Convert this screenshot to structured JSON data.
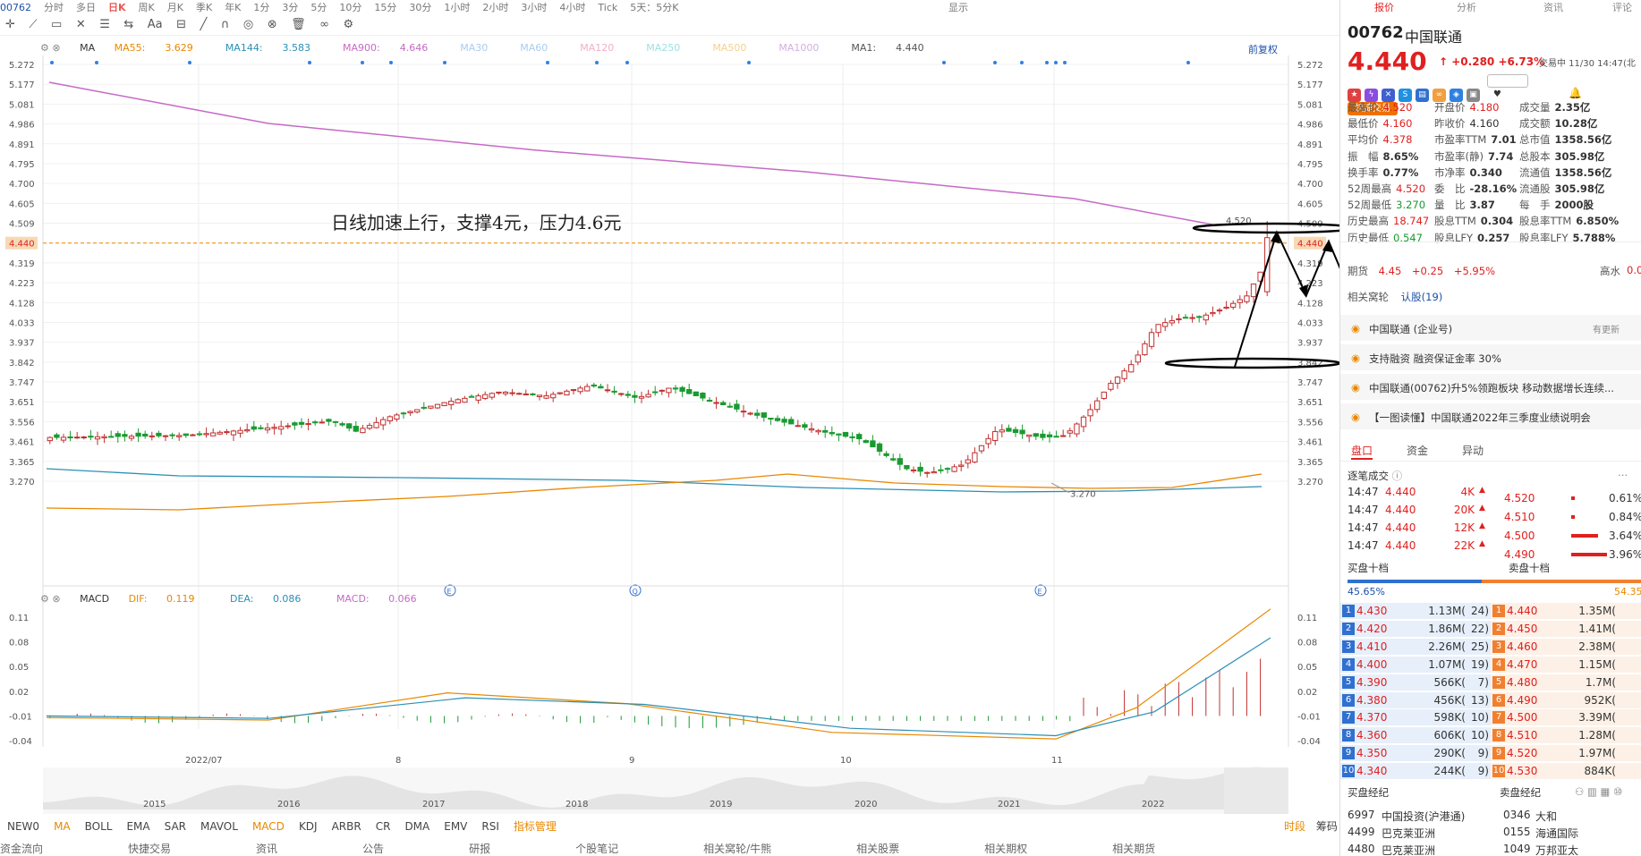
{
  "topbar": {
    "code": "00762",
    "items": [
      "分时",
      "多日",
      "日K",
      "周K",
      "月K",
      "季K",
      "年K",
      "1分",
      "3分",
      "5分",
      "10分",
      "15分",
      "30分",
      "1小时",
      "2小时",
      "3小时",
      "4小时",
      "Tick",
      "5天：5分K"
    ],
    "active_index": 2,
    "right_label": "显示"
  },
  "ma_legend": {
    "ma_label": "MA",
    "items": [
      {
        "label": "MA55:",
        "value": "3.629",
        "color": "#e88800"
      },
      {
        "label": "MA144:",
        "value": "3.583",
        "color": "#2b8fb5"
      },
      {
        "label": "MA900:",
        "value": "4.646",
        "color": "#c56ac5"
      },
      {
        "label": "MA30",
        "value": "",
        "color": "#aaccee"
      },
      {
        "label": "MA60",
        "value": "",
        "color": "#aaccee"
      },
      {
        "label": "MA120",
        "value": "",
        "color": "#f0b0c8"
      },
      {
        "label": "MA250",
        "value": "",
        "color": "#a0e0e0"
      },
      {
        "label": "MA500",
        "value": "",
        "color": "#f5d090"
      },
      {
        "label": "MA1000",
        "value": "",
        "color": "#d0b0e0"
      },
      {
        "label": "MA1:",
        "value": "4.440",
        "color": "#555555"
      }
    ],
    "fq_label": "前复权"
  },
  "annotation": "日线加速上行，支撑4元，压力4.6元",
  "price_axis": [
    "5.272",
    "5.177",
    "5.081",
    "4.986",
    "4.891",
    "4.795",
    "4.700",
    "4.605",
    "4.509",
    "4.440",
    "4.319",
    "4.223",
    "4.128",
    "4.033",
    "3.937",
    "3.842",
    "3.747",
    "3.651",
    "3.556",
    "3.461",
    "3.365",
    "3.270"
  ],
  "current_price_label": "4.440",
  "high_label": "4.520",
  "low_label": "3.270",
  "date_axis": [
    "2022/07",
    "8",
    "9",
    "10",
    "11"
  ],
  "overview_years": [
    "2015",
    "2016",
    "2017",
    "2018",
    "2019",
    "2020",
    "2021",
    "2022"
  ],
  "macd_legend": {
    "name": "MACD",
    "dif_label": "DIF:",
    "dif_value": "0.119",
    "dea_label": "DEA:",
    "dea_value": "0.086",
    "macd_label": "MACD:",
    "macd_value": "0.066"
  },
  "macd_axis": [
    "0.11",
    "0.08",
    "0.05",
    "0.02",
    "-0.01",
    "-0.04"
  ],
  "event_markers": [
    "E",
    "Q",
    "E"
  ],
  "bottom_tabs": [
    "NEW0",
    "MA",
    "BOLL",
    "EMA",
    "SAR",
    "MAVOL",
    "MACD",
    "KDJ",
    "ARBR",
    "CR",
    "DMA",
    "EMV",
    "RSI",
    "指标管理"
  ],
  "bottom_right": [
    "时段",
    "筹码"
  ],
  "bottom_row2": [
    "资金流向",
    "快捷交易",
    "资讯",
    "公告",
    "研报",
    "个股笔记",
    "相关窝轮/牛熊",
    "相关股票",
    "相关期权",
    "相关期货"
  ],
  "stock": {
    "code": "00762",
    "name": "中国联通",
    "price": "4.440",
    "change": "+0.280",
    "change_pct": "+6.73%",
    "trade_info": "交易中 11/30 14:47(北",
    "watch_label": "自选",
    "quick_trade": "快捷交易"
  },
  "quote": [
    [
      {
        "k": "最高价",
        "v": "4.520",
        "c": "red"
      },
      {
        "k": "开盘价",
        "v": "4.180",
        "c": "red"
      },
      {
        "k": "成交量",
        "v": "2.35亿",
        "c": "bold"
      }
    ],
    [
      {
        "k": "最低价",
        "v": "4.160",
        "c": "red"
      },
      {
        "k": "昨收价",
        "v": "4.160",
        "c": ""
      },
      {
        "k": "成交额",
        "v": "10.28亿",
        "c": "bold"
      }
    ],
    [
      {
        "k": "平均价",
        "v": "4.378",
        "c": "red"
      },
      {
        "k": "市盈率TTM",
        "v": "7.01",
        "c": "bold"
      },
      {
        "k": "总市值",
        "v": "1358.56亿",
        "c": "bold"
      }
    ],
    [
      {
        "k": "振　幅",
        "v": "8.65%",
        "c": "bold"
      },
      {
        "k": "市盈率(静)",
        "v": "7.74",
        "c": "bold"
      },
      {
        "k": "总股本",
        "v": "305.98亿",
        "c": "bold"
      }
    ],
    [
      {
        "k": "换手率",
        "v": "0.77%",
        "c": "bold"
      },
      {
        "k": "市净率",
        "v": "0.340",
        "c": "bold"
      },
      {
        "k": "流通值",
        "v": "1358.56亿",
        "c": "bold"
      }
    ],
    [
      {
        "k": "52周最高",
        "v": "4.520",
        "c": "red"
      },
      {
        "k": "委　比",
        "v": "-28.16%",
        "c": "bold"
      },
      {
        "k": "流通股",
        "v": "305.98亿",
        "c": "bold"
      }
    ],
    [
      {
        "k": "52周最低",
        "v": "3.270",
        "c": "green"
      },
      {
        "k": "量　比",
        "v": "3.87",
        "c": "bold"
      },
      {
        "k": "每　手",
        "v": "2000股",
        "c": "bold"
      }
    ],
    [
      {
        "k": "历史最高",
        "v": "18.747",
        "c": "red"
      },
      {
        "k": "股息TTM",
        "v": "0.304",
        "c": "bold"
      },
      {
        "k": "股息率TTM",
        "v": "6.850%",
        "c": "bold"
      }
    ],
    [
      {
        "k": "历史最低",
        "v": "0.547",
        "c": "green"
      },
      {
        "k": "股息LFY",
        "v": "0.257",
        "c": "bold"
      },
      {
        "k": "股息率LFY",
        "v": "5.788%",
        "c": "bold"
      }
    ]
  ],
  "futures": {
    "label": "期货",
    "price": "4.45",
    "change": "+0.25",
    "pct": "+5.95%",
    "right": "高水",
    "right_val": "0.0"
  },
  "related": {
    "label": "相关窝轮",
    "link": "认股(19)"
  },
  "news": [
    {
      "text": "中国联通 (企业号)",
      "right": "有更新"
    },
    {
      "text": "支持融资 融资保证金率 30%",
      "right": ""
    },
    {
      "text": "中国联通(00762)升5%领跑板块 移动数据增长连续...",
      "right": ""
    },
    {
      "text": "【一图读懂】中国联通2022年三季度业绩说明会",
      "right": ""
    }
  ],
  "pankou_tabs": [
    "盘口",
    "资金",
    "异动"
  ],
  "ticks_title": "逐笔成交",
  "ticks": [
    {
      "t": "14:47",
      "p": "4.440",
      "v": "4K"
    },
    {
      "t": "14:47",
      "p": "4.440",
      "v": "20K"
    },
    {
      "t": "14:47",
      "p": "4.440",
      "v": "12K"
    },
    {
      "t": "14:47",
      "p": "4.440",
      "v": "22K"
    }
  ],
  "dist": [
    {
      "p": "4.520",
      "pct": "0.61%"
    },
    {
      "p": "4.510",
      "pct": "0.84%"
    },
    {
      "p": "4.500",
      "pct": "3.64%"
    },
    {
      "p": "4.490",
      "pct": "3.96%"
    }
  ],
  "book": {
    "bid_title": "买盘十档",
    "ask_title": "卖盘十档",
    "bid_pct": "45.65%",
    "ask_pct": "54.35",
    "bids": [
      {
        "n": "1",
        "p": "4.430",
        "q": "1.13M(",
        "c": "24)"
      },
      {
        "n": "2",
        "p": "4.420",
        "q": "1.86M(",
        "c": "22)"
      },
      {
        "n": "3",
        "p": "4.410",
        "q": "2.26M(",
        "c": "25)"
      },
      {
        "n": "4",
        "p": "4.400",
        "q": "1.07M(",
        "c": "19)"
      },
      {
        "n": "5",
        "p": "4.390",
        "q": "566K(",
        "c": "7)"
      },
      {
        "n": "6",
        "p": "4.380",
        "q": "456K(",
        "c": "13)"
      },
      {
        "n": "7",
        "p": "4.370",
        "q": "598K(",
        "c": "10)"
      },
      {
        "n": "8",
        "p": "4.360",
        "q": "606K(",
        "c": "10)"
      },
      {
        "n": "9",
        "p": "4.350",
        "q": "290K(",
        "c": "9)"
      },
      {
        "n": "10",
        "p": "4.340",
        "q": "244K(",
        "c": "9)"
      }
    ],
    "asks": [
      {
        "n": "1",
        "p": "4.440",
        "q": "1.35M("
      },
      {
        "n": "2",
        "p": "4.450",
        "q": "1.41M("
      },
      {
        "n": "3",
        "p": "4.460",
        "q": "2.38M("
      },
      {
        "n": "4",
        "p": "4.470",
        "q": "1.15M("
      },
      {
        "n": "5",
        "p": "4.480",
        "q": "1.7M("
      },
      {
        "n": "6",
        "p": "4.490",
        "q": "952K("
      },
      {
        "n": "7",
        "p": "4.500",
        "q": "3.39M("
      },
      {
        "n": "8",
        "p": "4.510",
        "q": "1.28M("
      },
      {
        "n": "9",
        "p": "4.520",
        "q": "1.97M("
      },
      {
        "n": "10",
        "p": "4.530",
        "q": "884K("
      }
    ]
  },
  "brokers": {
    "bid_title": "买盘经纪",
    "ask_title": "卖盘经纪",
    "bid": [
      {
        "id": "6997",
        "name": "中国投资(沪港通)"
      },
      {
        "id": "4499",
        "name": "巴克莱亚洲"
      },
      {
        "id": "4480",
        "name": "巴克莱亚洲"
      }
    ],
    "ask": [
      {
        "id": "0346",
        "name": "大和"
      },
      {
        "id": "0155",
        "name": "海通国际"
      },
      {
        "id": "1049",
        "name": "万邦亚太"
      }
    ]
  },
  "colors": {
    "up": "#e02020",
    "down": "#1a9a30",
    "ma55": "#e88800",
    "ma144": "#2b8fb5",
    "ma900": "#c56ac5",
    "accent": "#1c50a8"
  }
}
